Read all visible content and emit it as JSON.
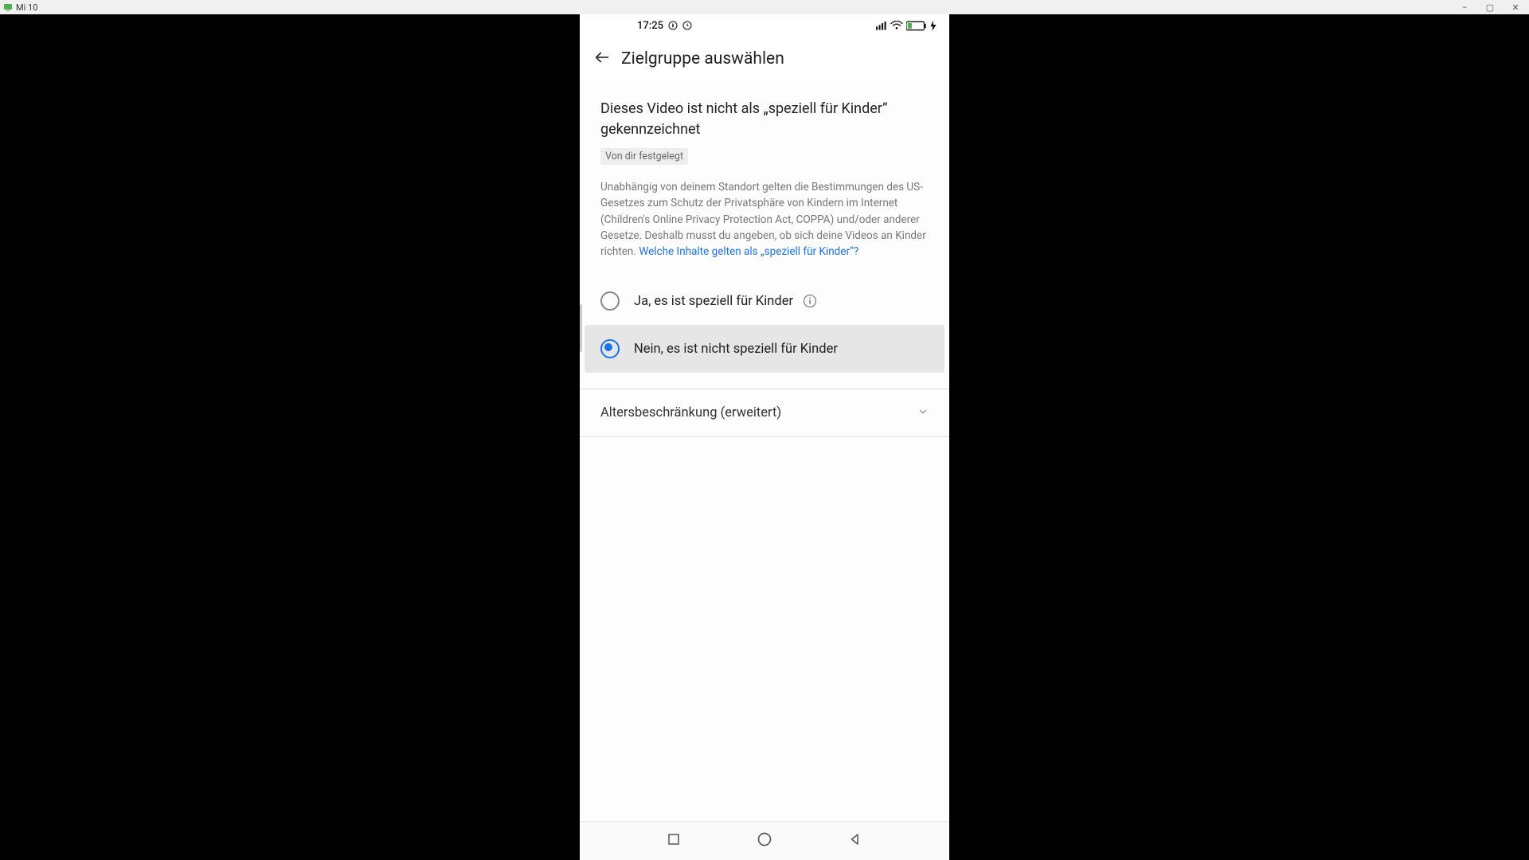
{
  "desktop": {
    "app_title": "Mi 10",
    "min_label": "−",
    "max_label": "▢",
    "close_label": "✕"
  },
  "status": {
    "time": "17:25",
    "battery_text": ""
  },
  "header": {
    "title": "Zielgruppe auswählen"
  },
  "main": {
    "headline": "Dieses Video ist nicht als „speziell für Kinder“ gekennzeichnet",
    "badge": "Von dir festgelegt",
    "body_text": "Unabhängig von deinem Standort gelten die Bestimmungen des US-Gesetzes zum Schutz der Privatsphäre von Kindern im Internet (Children's Online Privacy Protection Act, COPPA) und/oder anderer Gesetze. Deshalb musst du angeben, ob sich deine Videos an Kinder richten. ",
    "body_link": "Welche Inhalte gelten als „speziell für Kinder“?",
    "options": [
      {
        "label": "Ja, es ist speziell für Kinder",
        "selected": false,
        "has_info": true
      },
      {
        "label": "Nein, es ist nicht speziell für Kinder",
        "selected": true,
        "has_info": false
      }
    ],
    "accordion_label": "Altersbeschränkung (erweitert)"
  }
}
